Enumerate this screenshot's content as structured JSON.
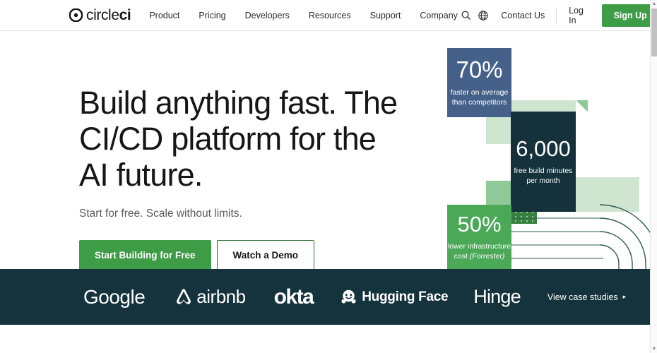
{
  "header": {
    "logo": {
      "light": "circle",
      "bold": "ci",
      "icon": "circleci-logo-icon"
    },
    "nav": [
      {
        "label": "Product"
      },
      {
        "label": "Pricing"
      },
      {
        "label": "Developers"
      },
      {
        "label": "Resources"
      },
      {
        "label": "Support"
      },
      {
        "label": "Company"
      }
    ],
    "search_icon": "search-icon",
    "globe_icon": "globe-icon",
    "contact": "Contact Us",
    "login": "Log In",
    "signup": "Sign Up"
  },
  "hero": {
    "headline": "Build anything fast. The CI/CD platform for the AI future.",
    "subhead": "Start for free. Scale without limits.",
    "primary_cta": "Start Building for Free",
    "secondary_cta": "Watch a Demo"
  },
  "stats": [
    {
      "value": "70%",
      "caption_line1": "faster on average",
      "caption_line2": "than competitors",
      "color": "#456089"
    },
    {
      "value": "6,000",
      "caption_line1": "free build minutes",
      "caption_line2": "per month",
      "color": "#14313c"
    },
    {
      "value": "50%",
      "caption_line1": "lower infrastructure",
      "caption_line2": "cost ",
      "caption_italic": "(Forrester)",
      "color": "#4aa857"
    }
  ],
  "logo_band": {
    "background": "#14333c",
    "brands": [
      {
        "name": "Google"
      },
      {
        "name": "airbnb"
      },
      {
        "name": "okta"
      },
      {
        "name": "Hugging Face"
      },
      {
        "name": "Hinge"
      }
    ],
    "case_link": "View case studies",
    "case_link_arrow": "▸"
  },
  "colors": {
    "brand_green": "#3e9c46",
    "card_blue": "#456089",
    "card_dark": "#14313c",
    "card_green": "#4aa857",
    "band_dark": "#14333c",
    "light_green": "#cfe5d0"
  },
  "scrollbar": {
    "up": "▲",
    "down": "▼"
  }
}
